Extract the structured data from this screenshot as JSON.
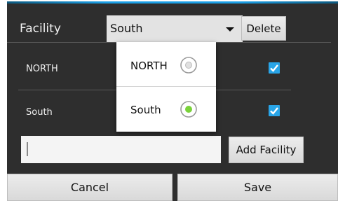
{
  "header": {
    "facility_label": "Facility",
    "selected_facility": "South",
    "delete_label": "Delete"
  },
  "facilities": [
    {
      "name": "NORTH",
      "checked": true
    },
    {
      "name": "South",
      "checked": true
    }
  ],
  "dropdown": {
    "options": [
      {
        "label": "NORTH",
        "selected": false
      },
      {
        "label": "South",
        "selected": true
      }
    ]
  },
  "add_facility": {
    "input_value": "",
    "button_label": "Add Facility"
  },
  "footer": {
    "cancel_label": "Cancel",
    "save_label": "Save"
  },
  "colors": {
    "accent": "#1a9fe6",
    "checkbox": "#29a5e8",
    "radio_selected": "#7ad23a",
    "dialog_background": "#2e2e2e"
  }
}
